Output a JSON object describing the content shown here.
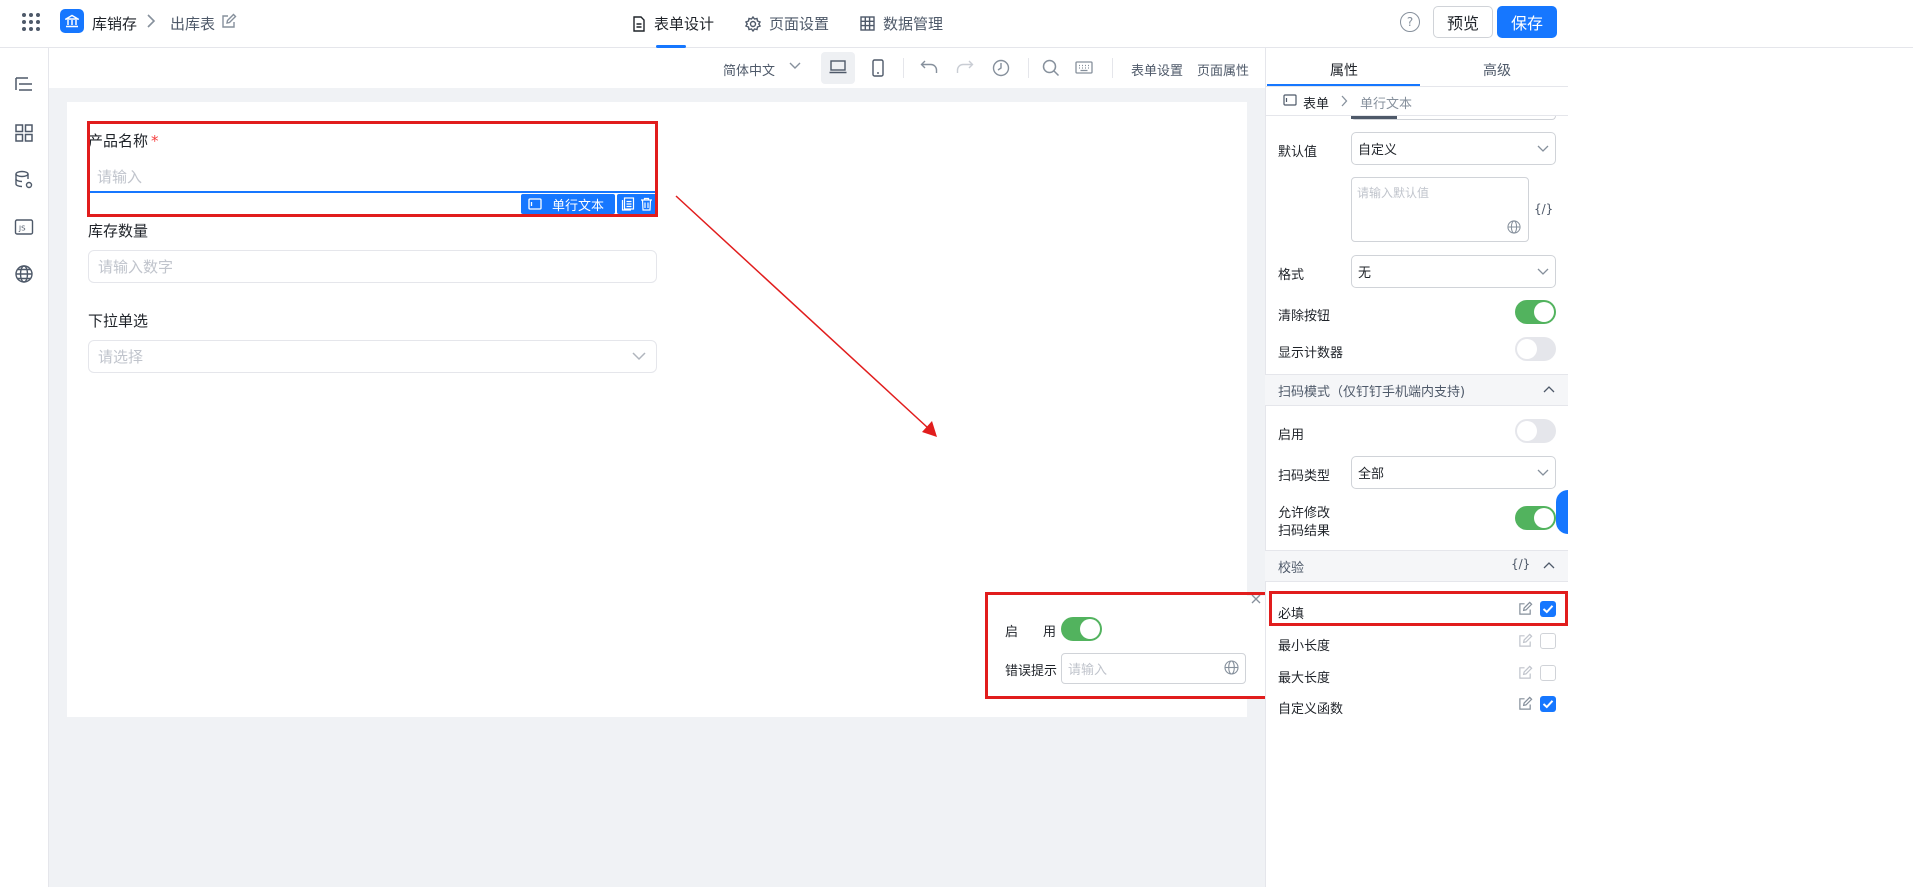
{
  "header": {
    "app_name": "库销存",
    "page_name": "出库表",
    "tabs": [
      {
        "label": "表单设计",
        "active": true
      },
      {
        "label": "页面设置",
        "active": false
      },
      {
        "label": "数据管理",
        "active": false
      }
    ],
    "help": "?",
    "preview_label": "预览",
    "save_label": "保存"
  },
  "toolbar": {
    "language": "简体中文",
    "form_settings": "表单设置",
    "page_props": "页面属性"
  },
  "form": {
    "fields": [
      {
        "label": "产品名称",
        "required": "*",
        "placeholder": "请输入"
      },
      {
        "label": "库存数量",
        "placeholder": "请输入数字"
      },
      {
        "label": "下拉单选",
        "placeholder": "请选择"
      }
    ],
    "selected_tag": "单行文本"
  },
  "popup": {
    "enable_label_a": "启",
    "enable_label_b": "用",
    "error_label": "错误提示",
    "error_placeholder": "请输入"
  },
  "panel": {
    "tabs": [
      "属性",
      "高级"
    ],
    "breadcrumb_root": "表单",
    "breadcrumb_leaf": "单行文本",
    "default_label": "默认值",
    "default_select": "自定义",
    "default_placeholder": "请输入默认值",
    "expr": "{/}",
    "format_label": "格式",
    "format_select": "无",
    "clear_btn_label": "清除按钮",
    "counter_label": "显示计数器",
    "scan_section": "扫码模式（仅钉钉手机端内支持)",
    "scan_enable": "启用",
    "scan_type_label": "扫码类型",
    "scan_type_select": "全部",
    "allow_edit_line1": "允许修改",
    "allow_edit_line2": "扫码结果",
    "validation_section": "校验",
    "validations": [
      {
        "label": "必填",
        "checked": true
      },
      {
        "label": "最小长度",
        "checked": false
      },
      {
        "label": "最大长度",
        "checked": false
      },
      {
        "label": "自定义函数",
        "checked": true
      }
    ]
  },
  "colors": {
    "accent": "#1677ff",
    "toggle_on": "#52b35e",
    "annotation": "#e11d1d"
  }
}
